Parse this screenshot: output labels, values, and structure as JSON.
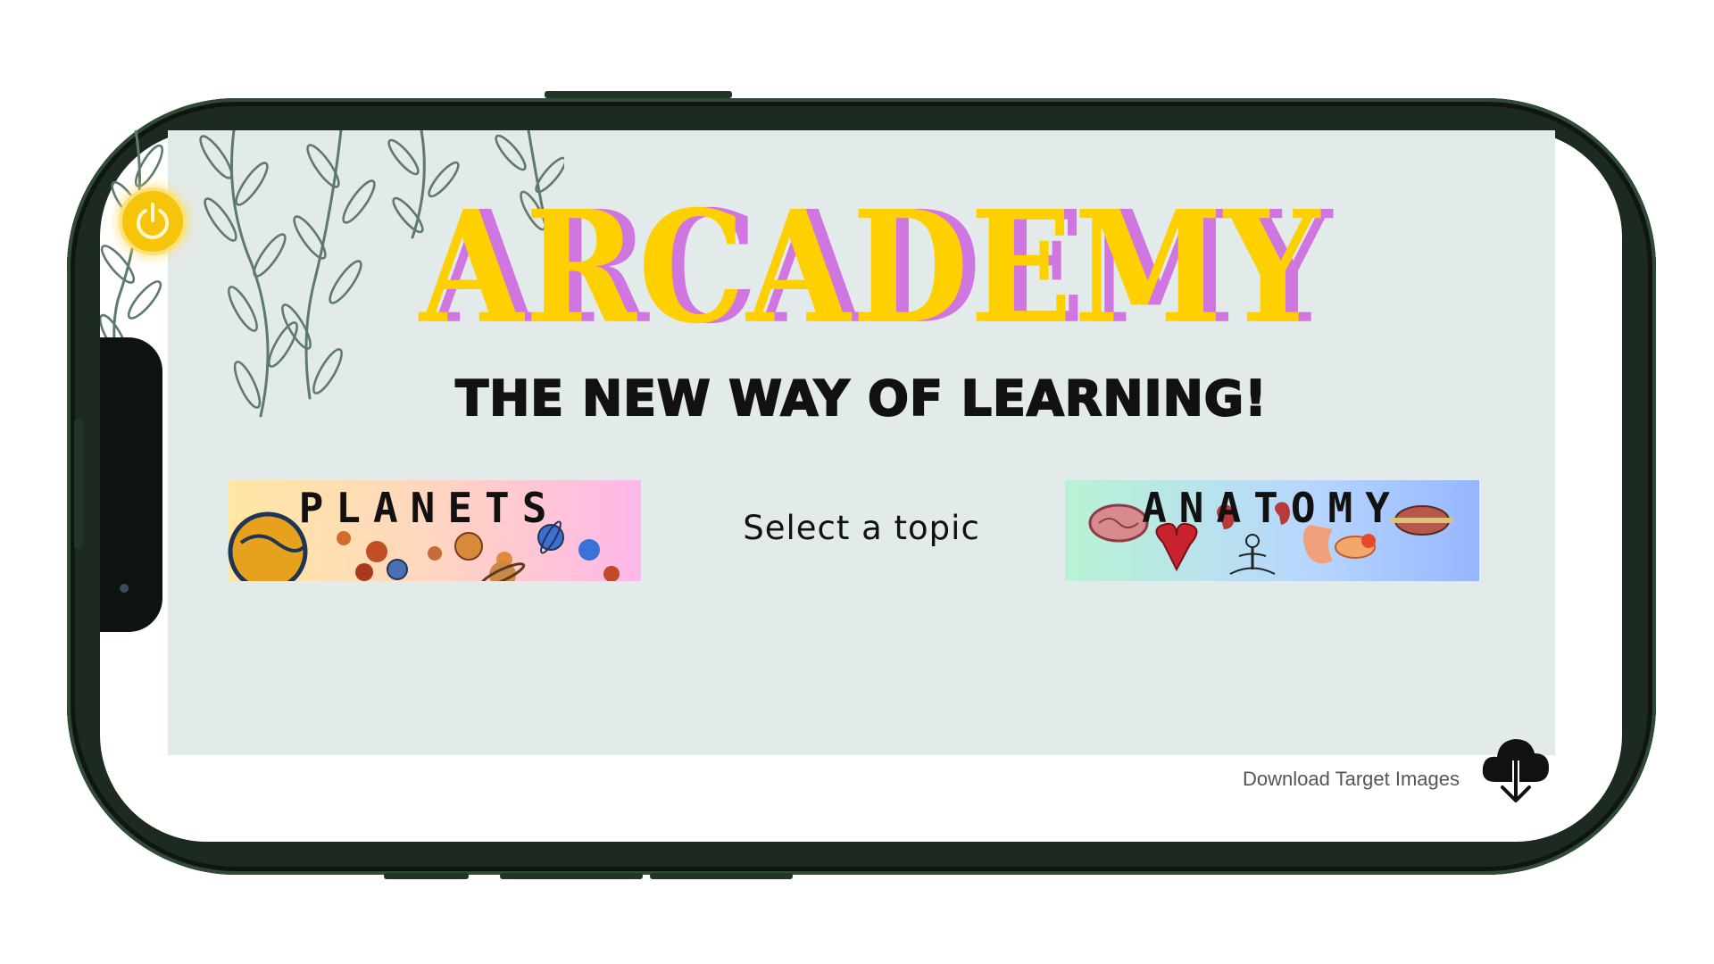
{
  "app": {
    "title": "ARCADEMY",
    "tagline": "THE NEW WAY OF LEARNING!",
    "prompt": "Select a topic"
  },
  "topics": [
    {
      "label": "PLANETS"
    },
    {
      "label": "ANATOMY"
    }
  ],
  "footer": {
    "download_label": "Download Target Images"
  },
  "icons": {
    "power": "power-icon",
    "download": "cloud-download-icon"
  },
  "colors": {
    "logo_fill": "#ffd000",
    "logo_shadow": "#d076e0",
    "app_background": "#e3eaea",
    "power_button": "#f6c40a",
    "phone_frame": "#1c2a1f"
  }
}
